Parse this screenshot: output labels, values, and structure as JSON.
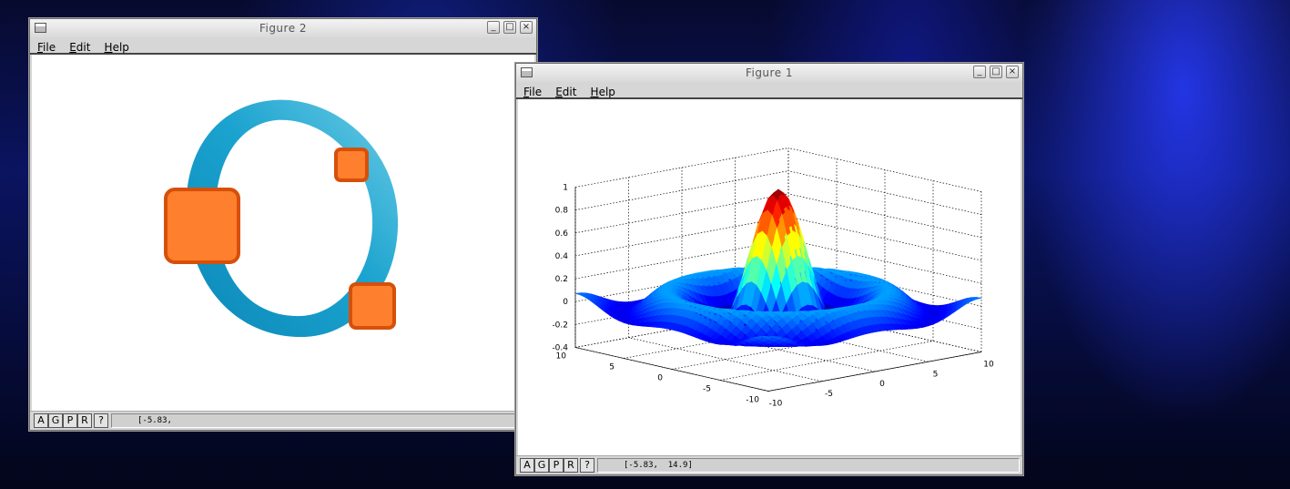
{
  "figure2": {
    "title": "Figure 2",
    "menu": [
      {
        "key": "F",
        "rest": "ile"
      },
      {
        "key": "E",
        "rest": "dit"
      },
      {
        "key": "H",
        "rest": "elp"
      }
    ],
    "toolbar": [
      "A",
      "G",
      "P",
      "R",
      "?"
    ],
    "coords": "[-5.83,"
  },
  "figure1": {
    "title": "Figure 1",
    "menu": [
      {
        "key": "F",
        "rest": "ile"
      },
      {
        "key": "E",
        "rest": "dit"
      },
      {
        "key": "H",
        "rest": "elp"
      }
    ],
    "toolbar": [
      "A",
      "G",
      "P",
      "R",
      "?"
    ],
    "coords": "[-5.83,  14.9]"
  },
  "window_controls": {
    "minimize": "_",
    "maximize": "□",
    "close": "×"
  },
  "colors": {
    "logo_ring": "#1ba3cf",
    "logo_square_fill": "#fe7f2d",
    "logo_square_border": "#d6500a"
  },
  "chart_data": {
    "type": "surface",
    "function": "sin(r)/r",
    "xlim": [
      -10,
      10
    ],
    "ylim": [
      -10,
      10
    ],
    "zlim": [
      -0.4,
      1
    ],
    "z_ticks": [
      "1",
      "0.8",
      "0.6",
      "0.4",
      "0.2",
      "0",
      "-0.2",
      "-0.4"
    ],
    "x_ticks": [
      "-10",
      "-5",
      "0",
      "5",
      "10"
    ],
    "y_ticks": [
      "10",
      "5",
      "0",
      "-5",
      "-10"
    ],
    "grid": true,
    "colormap": "jet"
  }
}
